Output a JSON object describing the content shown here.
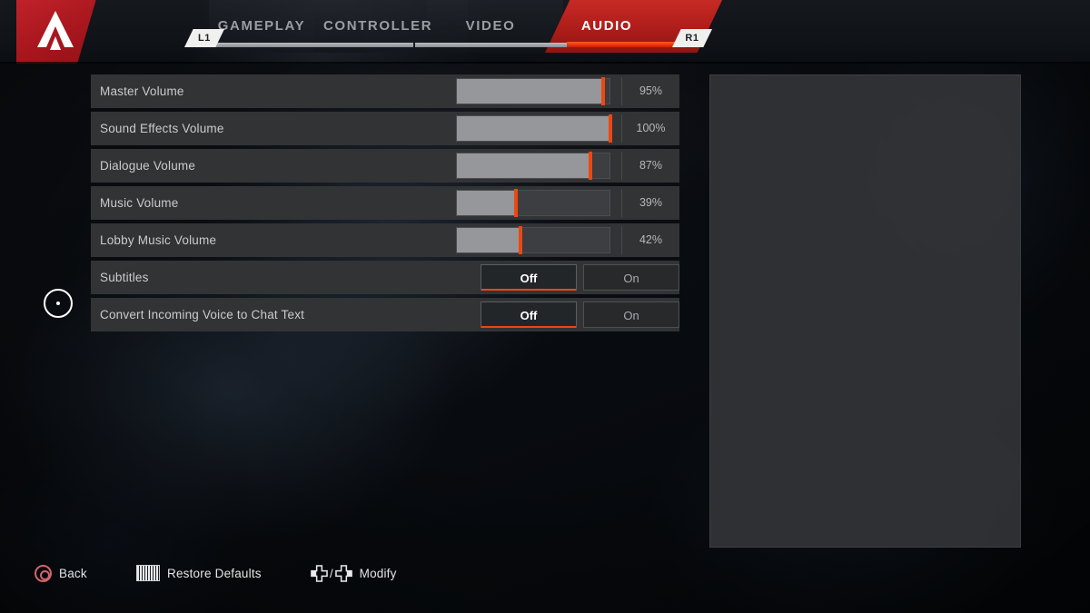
{
  "header": {
    "logo_icon": "apex-legends-logo-icon",
    "bumper_left": "L1",
    "bumper_right": "R1",
    "tabs": [
      {
        "label": "GAMEPLAY",
        "active": false
      },
      {
        "label": "CONTROLLER",
        "active": false
      },
      {
        "label": "VIDEO",
        "active": false
      },
      {
        "label": "AUDIO",
        "active": true
      }
    ]
  },
  "settings": {
    "rows": [
      {
        "label": "Master Volume",
        "type": "slider",
        "value": 95,
        "display": "95%"
      },
      {
        "label": "Sound Effects Volume",
        "type": "slider",
        "value": 100,
        "display": "100%"
      },
      {
        "label": "Dialogue Volume",
        "type": "slider",
        "value": 87,
        "display": "87%"
      },
      {
        "label": "Music Volume",
        "type": "slider",
        "value": 39,
        "display": "39%"
      },
      {
        "label": "Lobby Music Volume",
        "type": "slider",
        "value": 42,
        "display": "42%"
      },
      {
        "label": "Subtitles",
        "type": "toggle",
        "options": [
          "Off",
          "On"
        ],
        "selected": "Off"
      },
      {
        "label": "Convert Incoming Voice to Chat Text",
        "type": "toggle",
        "options": [
          "Off",
          "On"
        ],
        "selected": "Off"
      }
    ]
  },
  "cursor": {
    "icon": "mouse-cursor-icon"
  },
  "actionbar": {
    "items": [
      {
        "icon": "playstation-circle-button-icon",
        "label": "Back"
      },
      {
        "icon": "touchpad-button-icon",
        "label": "Restore Defaults"
      },
      {
        "icon": "dpad-left-right-icon",
        "label": "Modify"
      }
    ]
  },
  "colors": {
    "accent_orange": "#ee4711",
    "accent_red": "#c3232b",
    "row_background": "#313335",
    "slider_fill": "#95979a",
    "panel_background": "#343639"
  }
}
